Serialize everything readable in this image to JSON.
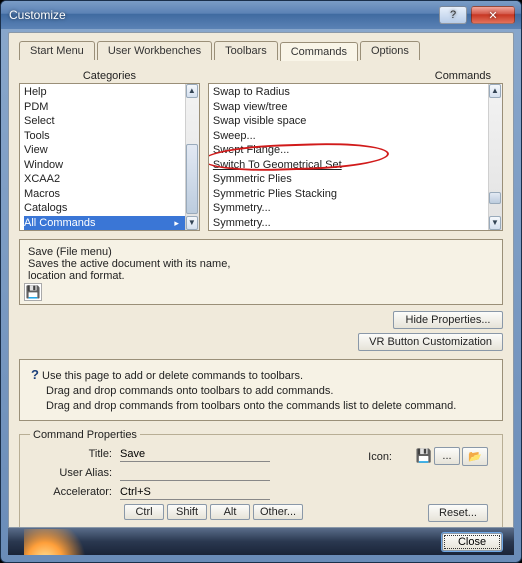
{
  "window": {
    "title": "Customize"
  },
  "tabs": {
    "items": [
      {
        "label": "Start Menu"
      },
      {
        "label": "User Workbenches"
      },
      {
        "label": "Toolbars"
      },
      {
        "label": "Commands",
        "active": true
      },
      {
        "label": "Options"
      }
    ]
  },
  "headers": {
    "categories": "Categories",
    "commands": "Commands"
  },
  "categories": {
    "items": [
      "Help",
      "PDM",
      "Select",
      "Tools",
      "View",
      "Window",
      "XCAA2",
      "Macros",
      "Catalogs",
      "All Commands"
    ],
    "selected": "All Commands"
  },
  "commands": {
    "items": [
      "Swap to Radius",
      "Swap view/tree",
      "Swap visible space",
      "Sweep...",
      "Swept Flange...",
      "Switch To Geometrical Set",
      "Symmetric Plies",
      "Symmetric Plies Stacking",
      "Symmetry...",
      "Symmetry..."
    ],
    "annotated_index": 5
  },
  "description": {
    "title": "Save (File menu)",
    "line1": "Saves the active document with its name,",
    "line2": "location and format."
  },
  "buttons": {
    "hide_props": "Hide Properties...",
    "vr": "VR Button Customization",
    "close": "Close",
    "reset": "Reset...",
    "ctrl": "Ctrl",
    "shift": "Shift",
    "alt": "Alt",
    "other": "Other...",
    "browse": "..."
  },
  "help": {
    "line1": "Use this page to add or delete commands to toolbars.",
    "line2": "Drag and drop commands onto toolbars to add commands.",
    "line3": "Drag and drop commands from toolbars onto the commands list to delete command."
  },
  "props": {
    "legend": "Command Properties",
    "title_label": "Title:",
    "title_value": "Save",
    "alias_label": "User Alias:",
    "alias_value": "",
    "accel_label": "Accelerator:",
    "accel_value": "Ctrl+S",
    "icon_label": "Icon:"
  },
  "icons": {
    "floppy": "💾",
    "folder": "📂",
    "help": "?",
    "close_x": "✕"
  }
}
